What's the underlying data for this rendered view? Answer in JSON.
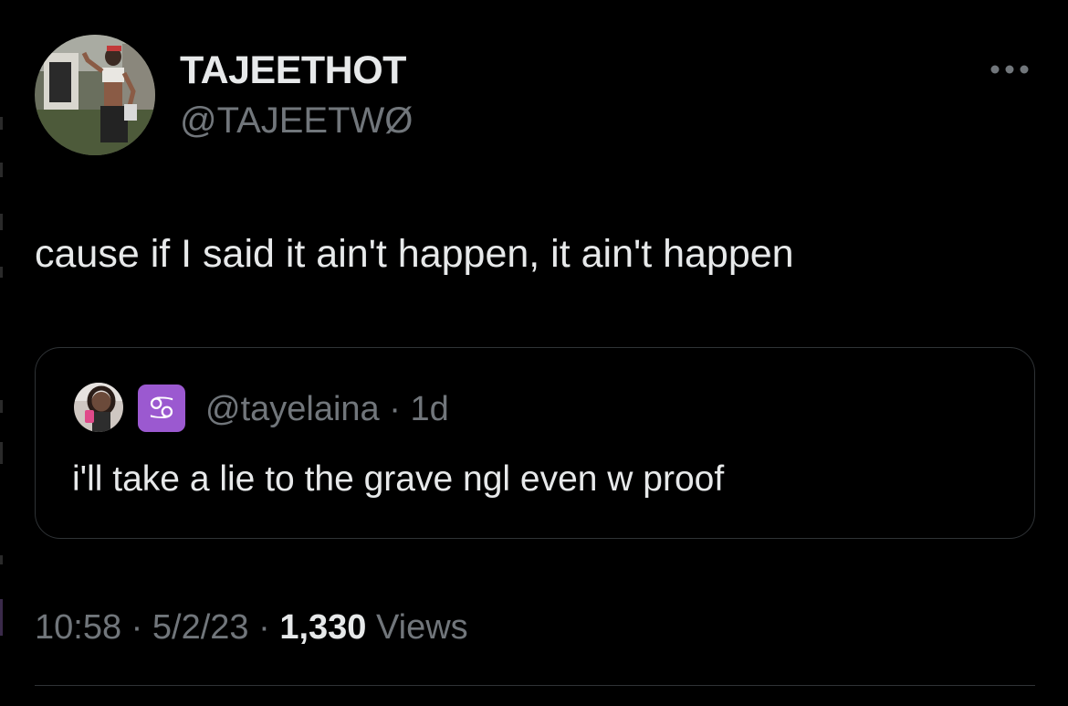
{
  "tweet": {
    "display_name": "TAJEETHOT",
    "handle": "@TAJEETWØ",
    "text": "cause if I said it ain't happen, it ain't happen",
    "more_icon": "more-horizontal-icon"
  },
  "quote": {
    "zodiac_glyph": "♋",
    "zodiac_color": "#9b59d0",
    "handle": "@tayelaina",
    "separator": "·",
    "age": "1d",
    "text": "i'll take a lie to the grave ngl even w proof"
  },
  "meta": {
    "time": "10:58",
    "separator": "·",
    "date": "5/2/23",
    "views_count": "1,330",
    "views_label": "Views"
  },
  "colors": {
    "background": "#000000",
    "primary_text": "#e7e9ea",
    "secondary_text": "#71767b",
    "border": "#2f3336"
  }
}
